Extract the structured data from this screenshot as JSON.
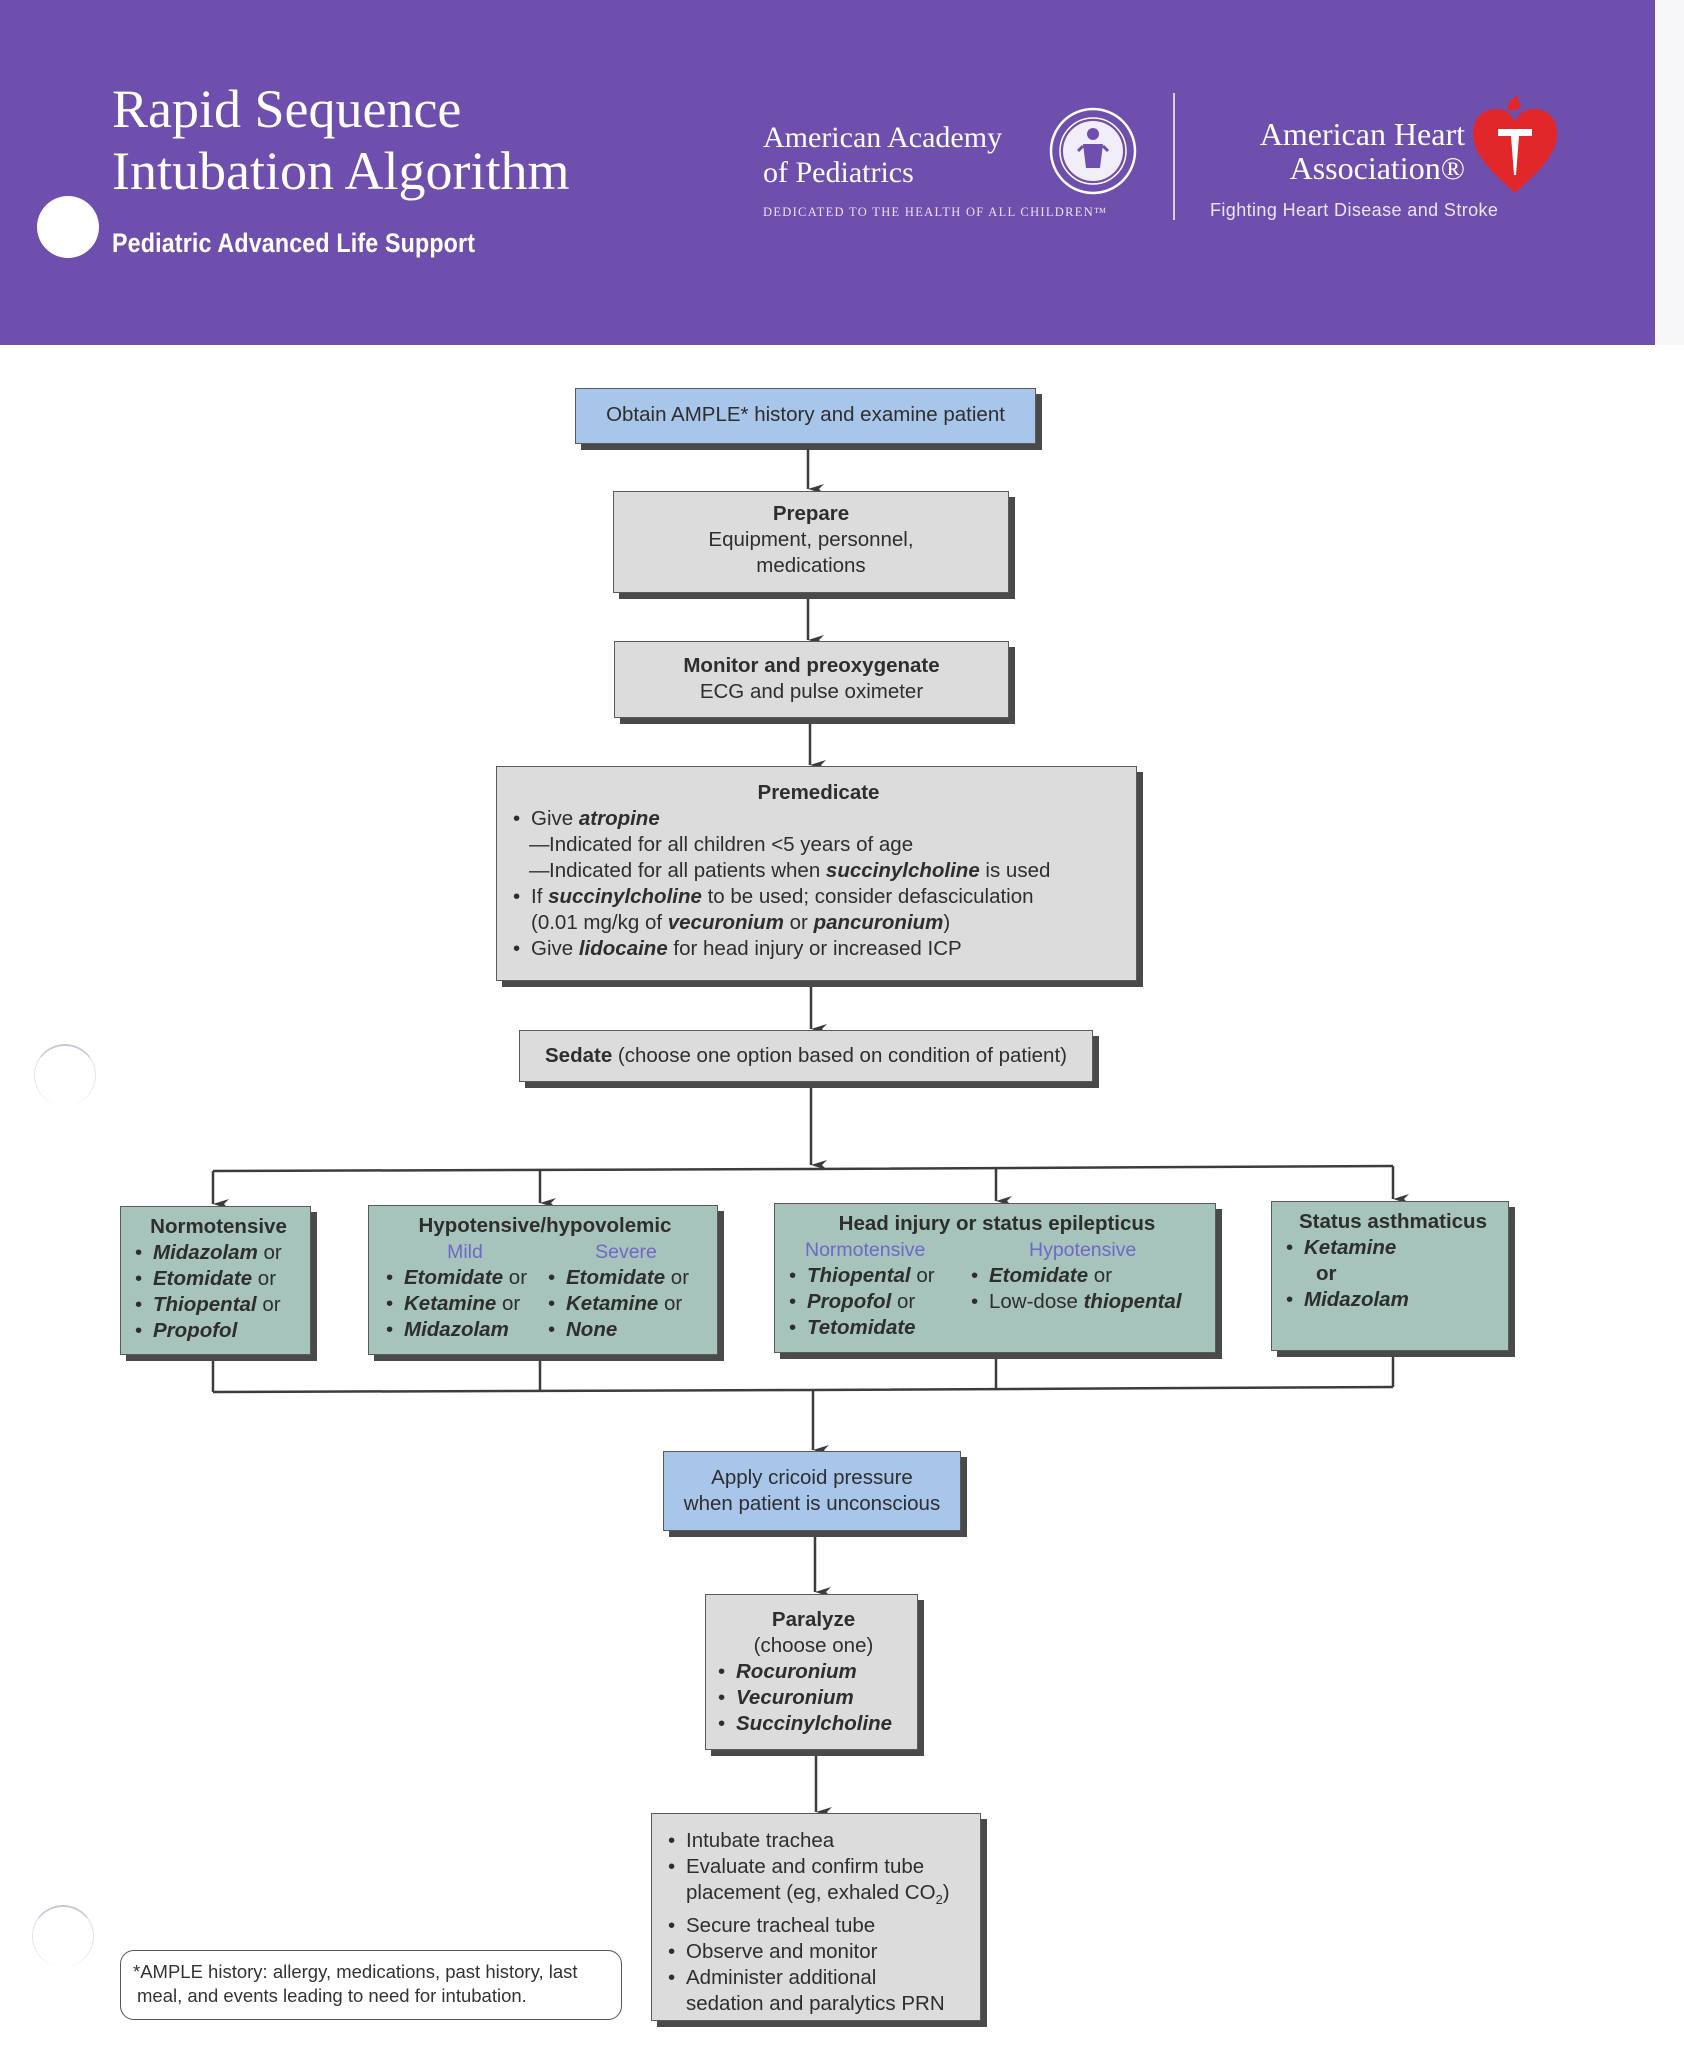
{
  "header": {
    "title_line1": "Rapid Sequence",
    "title_line2": "Intubation Algorithm",
    "subtitle": "Pediatric Advanced Life Support",
    "banner_color": "#6e4fae",
    "aap": {
      "name_line1": "American Academy",
      "name_line2": "of Pediatrics",
      "tagline": "DEDICATED TO THE HEALTH OF ALL CHILDREN™",
      "seal_icon": "aap-seal-icon"
    },
    "aha": {
      "name_line1": "American Heart",
      "name_line2": "Association®",
      "tagline": "Fighting Heart Disease and Stroke",
      "logo_icon": "heart-torch-icon",
      "logo_color": "#e2272b"
    }
  },
  "flow": {
    "ample": {
      "text": "Obtain AMPLE* history and examine patient"
    },
    "prepare": {
      "title": "Prepare",
      "line1": "Equipment, personnel,",
      "line2": "medications"
    },
    "monitor": {
      "title": "Monitor and preoxygenate",
      "line1": "ECG and pulse oximeter"
    },
    "premedicate": {
      "title": "Premedicate",
      "item1_pre": "Give ",
      "item1_drug": "atropine",
      "sub1": "Indicated for all children <5 years of age",
      "sub2_pre": "Indicated for all patients when ",
      "sub2_drug": "succinylcholine",
      "sub2_post": " is used",
      "item2_pre": "If ",
      "item2_drug": "succinylcholine",
      "item2_post": " to be used; consider defasciculation",
      "item2_line2_pre": "(0.01 mg/kg of ",
      "item2_drug2": "vecuronium",
      "item2_mid": " or ",
      "item2_drug3": "pancuronium",
      "item2_end": ")",
      "item3_pre": "Give ",
      "item3_drug": "lidocaine",
      "item3_post": " for head injury or increased ICP"
    },
    "sedate": {
      "title": "Sedate",
      "text": " (choose one option based on condition of patient)"
    },
    "options": {
      "normotensive": {
        "title": "Normotensive",
        "items": [
          {
            "drug": "Midazolam",
            "suffix": " or"
          },
          {
            "drug": "Etomidate",
            "suffix": " or"
          },
          {
            "drug": "Thiopental",
            "suffix": " or"
          },
          {
            "drug": "Propofol",
            "suffix": ""
          }
        ]
      },
      "hypotensive": {
        "title": "Hypotensive/hypovolemic",
        "mild_label": "Mild",
        "severe_label": "Severe",
        "mild": [
          {
            "drug": "Etomidate",
            "suffix": " or"
          },
          {
            "drug": "Ketamine",
            "suffix": " or"
          },
          {
            "drug": "Midazolam",
            "suffix": ""
          }
        ],
        "severe": [
          {
            "drug": "Etomidate",
            "suffix": " or"
          },
          {
            "drug": "Ketamine",
            "suffix": " or"
          },
          {
            "drug": "None",
            "suffix": ""
          }
        ]
      },
      "head_injury": {
        "title": "Head injury or status epilepticus",
        "normo_label": "Normotensive",
        "hypo_label": "Hypotensive",
        "normo": [
          {
            "drug": "Thiopental",
            "suffix": " or"
          },
          {
            "drug": "Propofol",
            "suffix": " or"
          },
          {
            "drug": "Tetomidate",
            "suffix": ""
          }
        ],
        "hypo_item1_drug": "Etomidate",
        "hypo_item1_suffix": " or",
        "hypo_item2_prefix": "Low-dose ",
        "hypo_item2_drug": "thiopental"
      },
      "asthmaticus": {
        "title": "Status asthmaticus",
        "item1_drug": "Ketamine",
        "or_label": "or",
        "item2_drug": "Midazolam"
      }
    },
    "cricoid": {
      "line1": "Apply cricoid pressure",
      "line2": "when patient is unconscious"
    },
    "paralyze": {
      "title": "Paralyze",
      "subtitle": "(choose one)",
      "items": [
        "Rocuronium",
        "Vecuronium",
        "Succinylcholine"
      ]
    },
    "final": {
      "items": [
        "Intubate trachea",
        "Evaluate and confirm tube",
        "Secure tracheal tube",
        "Observe and monitor",
        "Administer additional"
      ],
      "item2_line2": "placement (eg, exhaled CO",
      "item2_sub": "2",
      "item2_end": ")",
      "item5_line2": "sedation and paralytics PRN"
    }
  },
  "footnote": {
    "line1": "*AMPLE history: allergy, medications, past history, last",
    "line2": "meal, and events leading to need for intubation."
  }
}
